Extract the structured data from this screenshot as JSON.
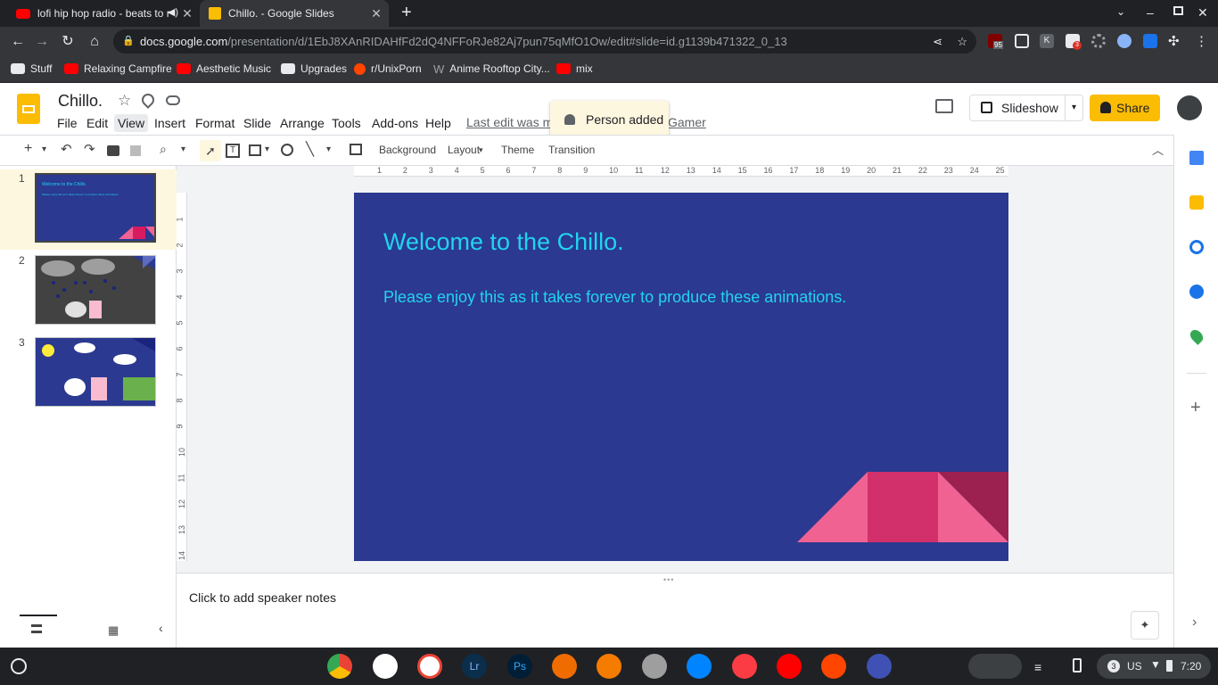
{
  "browser": {
    "tabs": [
      {
        "title": "lofi hip hop radio - beats to r",
        "active": false
      },
      {
        "title": "Chillo. - Google Slides",
        "active": true
      }
    ],
    "url_domain": "docs.google.com",
    "url_path": "/presentation/d/1EbJ8XAnRIDAHfFd2dQ4NFFoRJe82Aj7pun75qMfO1Ow/edit#slide=id.g1139b471322_0_13",
    "bookmarks": [
      "Stuff",
      "Relaxing Campfire",
      "Aesthetic Music",
      "Upgrades",
      "r/UnixPorn",
      "Anime Rooftop City...",
      "mix"
    ],
    "ext_badges": {
      "ublock": "95",
      "folder": "3"
    }
  },
  "app": {
    "doc_title": "Chillo.",
    "menus": [
      "File",
      "Edit",
      "View",
      "Insert",
      "Format",
      "Slide",
      "Arrange",
      "Tools",
      "Add-ons",
      "Help"
    ],
    "last_edit": "Last edit was ma",
    "last_edit_tail": "Gamer",
    "toast": "Person added",
    "slideshow_label": "Slideshow",
    "share_label": "Share"
  },
  "toolbar": {
    "background": "Background",
    "layout": "Layout",
    "theme": "Theme",
    "transition": "Transition"
  },
  "ruler": {
    "h_ticks": [
      "1",
      "2",
      "3",
      "4",
      "5",
      "6",
      "7",
      "8",
      "9",
      "10",
      "11",
      "12",
      "13",
      "14",
      "15",
      "16",
      "17",
      "18",
      "19",
      "20",
      "21",
      "22",
      "23",
      "24",
      "25"
    ],
    "v_ticks": [
      "1",
      "2",
      "3",
      "4",
      "5",
      "6",
      "7",
      "8",
      "9",
      "10",
      "11",
      "12",
      "13",
      "14"
    ]
  },
  "slides": {
    "numbers": [
      "1",
      "2",
      "3"
    ],
    "thumb1_title": "Welcome to the Chillo.",
    "thumb1_body": "Please enjoy this as it takes forever to produce these animations."
  },
  "slide": {
    "title": "Welcome to the Chillo.",
    "body": "Please enjoy this as it takes forever to produce these animations.",
    "colors": {
      "bg": "#2b3990",
      "text": "#22d3ee",
      "pink": "#f06292",
      "magenta": "#d81b60",
      "maroon": "#9c2050"
    }
  },
  "notes": {
    "placeholder": "Click to add speaker notes"
  },
  "shelf": {
    "apps": [
      "Chrome",
      "Play Store",
      "Gmail",
      "Lightroom",
      "Photoshop",
      "Sketchbook",
      "VLC",
      "Roblox",
      "Messenger",
      "Apple Music",
      "YouTube",
      "Reddit",
      "Chrome Canary"
    ],
    "tray": {
      "notif_count": "3",
      "locale": "US",
      "time": "7:20"
    }
  }
}
